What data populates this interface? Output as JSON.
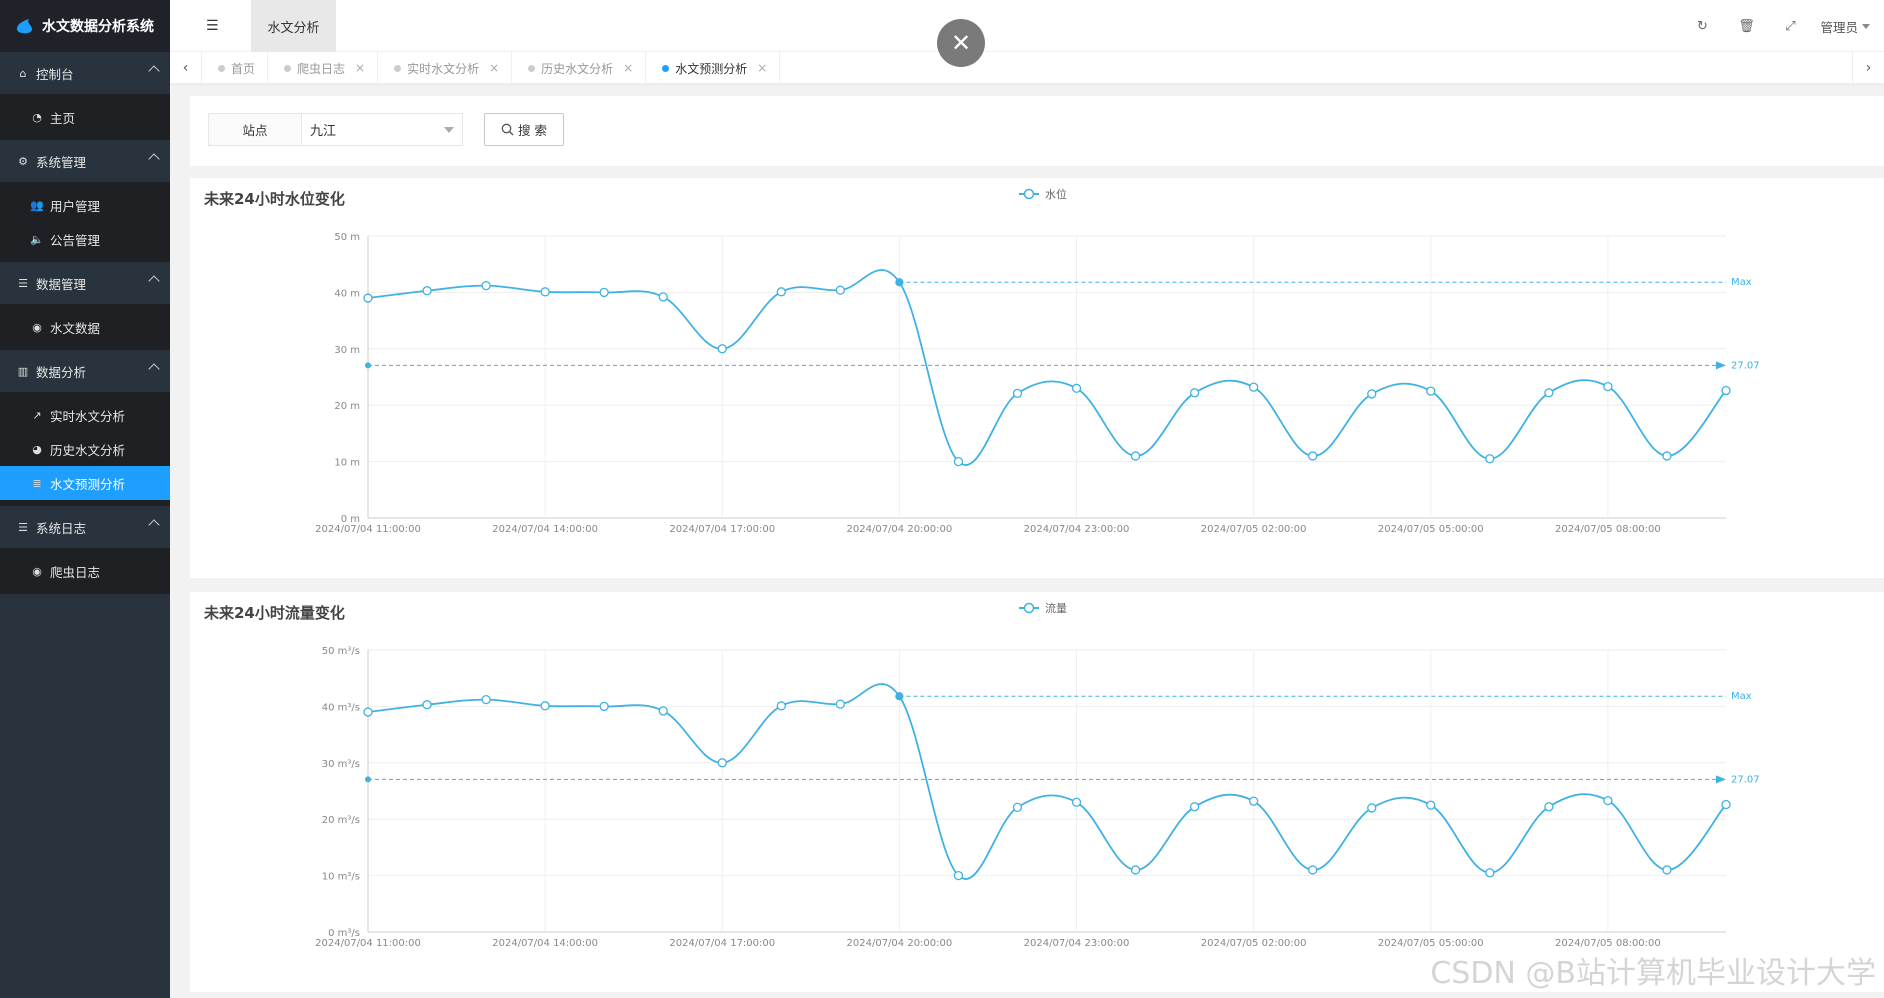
{
  "app": {
    "title": "水文数据分析系统"
  },
  "sidebar": {
    "groups": [
      {
        "label": "控制台",
        "icon": "home-icon",
        "items": [
          {
            "label": "主页",
            "icon": "dashboard-icon"
          }
        ]
      },
      {
        "label": "系统管理",
        "icon": "cogs-icon",
        "items": [
          {
            "label": "用户管理",
            "icon": "users-icon"
          },
          {
            "label": "公告管理",
            "icon": "volume-icon"
          }
        ]
      },
      {
        "label": "数据管理",
        "icon": "list-icon",
        "items": [
          {
            "label": "水文数据",
            "icon": "globe-icon"
          }
        ]
      },
      {
        "label": "数据分析",
        "icon": "bar-chart-icon",
        "items": [
          {
            "label": "实时水文分析",
            "icon": "line-chart-icon"
          },
          {
            "label": "历史水文分析",
            "icon": "pie-chart-icon"
          },
          {
            "label": "水文预测分析",
            "icon": "database-icon",
            "active": true
          }
        ]
      },
      {
        "label": "系统日志",
        "icon": "list-icon",
        "items": [
          {
            "label": "爬虫日志",
            "icon": "globe-icon"
          }
        ]
      }
    ]
  },
  "header": {
    "module_tab": "水文分析",
    "user": "管理员"
  },
  "tabs": [
    {
      "label": "首页",
      "closable": false
    },
    {
      "label": "爬虫日志",
      "closable": true
    },
    {
      "label": "实时水文分析",
      "closable": true
    },
    {
      "label": "历史水文分析",
      "closable": true
    },
    {
      "label": "水文预测分析",
      "closable": true,
      "active": true
    }
  ],
  "search": {
    "station_label": "站点",
    "station_value": "九江",
    "button_label": "搜 索"
  },
  "charts": [
    {
      "title": "未来24小时水位变化",
      "legend": "水位",
      "unit": "m",
      "max_label": "Max",
      "avg_label": "27.07"
    },
    {
      "title": "未来24小时流量变化",
      "legend": "流量",
      "unit": "m³/s",
      "max_label": "Max",
      "avg_label": "27.07"
    }
  ],
  "chart_data": [
    {
      "type": "line",
      "title": "未来24小时水位变化",
      "series": [
        {
          "name": "水位",
          "values": [
            39.0,
            40.3,
            41.2,
            40.1,
            40.0,
            39.2,
            30.0,
            40.1,
            40.4,
            41.8,
            10.0,
            22.1,
            23.0,
            11.0,
            22.2,
            23.2,
            11.0,
            22.0,
            22.5,
            10.5,
            22.2,
            23.3,
            11.0,
            22.6
          ],
          "color": "#3fb1e3"
        }
      ],
      "x": [
        "2024/07/04 11:00:00",
        "2024/07/04 12:00:00",
        "2024/07/04 13:00:00",
        "2024/07/04 14:00:00",
        "2024/07/04 15:00:00",
        "2024/07/04 16:00:00",
        "2024/07/04 17:00:00",
        "2024/07/04 18:00:00",
        "2024/07/04 19:00:00",
        "2024/07/04 20:00:00",
        "2024/07/04 21:00:00",
        "2024/07/04 22:00:00",
        "2024/07/04 23:00:00",
        "2024/07/05 00:00:00",
        "2024/07/05 01:00:00",
        "2024/07/05 02:00:00",
        "2024/07/05 03:00:00",
        "2024/07/05 04:00:00",
        "2024/07/05 05:00:00",
        "2024/07/05 06:00:00",
        "2024/07/05 07:00:00",
        "2024/07/05 08:00:00",
        "2024/07/05 09:00:00",
        "2024/07/05 10:00:00"
      ],
      "x_tick_labels": [
        "2024/07/04 11:00:00",
        "2024/07/04 14:00:00",
        "2024/07/04 17:00:00",
        "2024/07/04 20:00:00",
        "2024/07/04 23:00:00",
        "2024/07/05 02:00:00",
        "2024/07/05 05:00:00",
        "2024/07/05 08:00:00"
      ],
      "y_ticks": [
        "0 m",
        "10 m",
        "20 m",
        "30 m",
        "40 m",
        "50 m"
      ],
      "ylim": [
        0,
        50
      ],
      "mark_line_max": 41.8,
      "mark_line_avg": 27.07,
      "legend_position": "top-center",
      "grid": true
    },
    {
      "type": "line",
      "title": "未来24小时流量变化",
      "series": [
        {
          "name": "流量",
          "values": [
            39.0,
            40.3,
            41.2,
            40.1,
            40.0,
            39.2,
            30.0,
            40.1,
            40.4,
            41.8,
            10.0,
            22.1,
            23.0,
            11.0,
            22.2,
            23.2,
            11.0,
            22.0,
            22.5,
            10.5,
            22.2,
            23.3,
            11.0,
            22.6
          ],
          "color": "#3fb1e3"
        }
      ],
      "x": [
        "2024/07/04 11:00:00",
        "2024/07/04 12:00:00",
        "2024/07/04 13:00:00",
        "2024/07/04 14:00:00",
        "2024/07/04 15:00:00",
        "2024/07/04 16:00:00",
        "2024/07/04 17:00:00",
        "2024/07/04 18:00:00",
        "2024/07/04 19:00:00",
        "2024/07/04 20:00:00",
        "2024/07/04 21:00:00",
        "2024/07/04 22:00:00",
        "2024/07/04 23:00:00",
        "2024/07/05 00:00:00",
        "2024/07/05 01:00:00",
        "2024/07/05 02:00:00",
        "2024/07/05 03:00:00",
        "2024/07/05 04:00:00",
        "2024/07/05 05:00:00",
        "2024/07/05 06:00:00",
        "2024/07/05 07:00:00",
        "2024/07/05 08:00:00",
        "2024/07/05 09:00:00",
        "2024/07/05 10:00:00"
      ],
      "x_tick_labels": [
        "2024/07/04 11:00:00",
        "2024/07/04 14:00:00",
        "2024/07/04 17:00:00",
        "2024/07/04 20:00:00",
        "2024/07/04 23:00:00",
        "2024/07/05 02:00:00",
        "2024/07/05 05:00:00",
        "2024/07/05 08:00:00"
      ],
      "y_ticks": [
        "0 m³/s",
        "10 m³/s",
        "20 m³/s",
        "30 m³/s",
        "40 m³/s",
        "50 m³/s"
      ],
      "ylim": [
        0,
        50
      ],
      "mark_line_max": 41.8,
      "mark_line_avg": 27.07,
      "legend_position": "top-center",
      "grid": true
    }
  ],
  "watermark": "CSDN @B站计算机毕业设计大学"
}
